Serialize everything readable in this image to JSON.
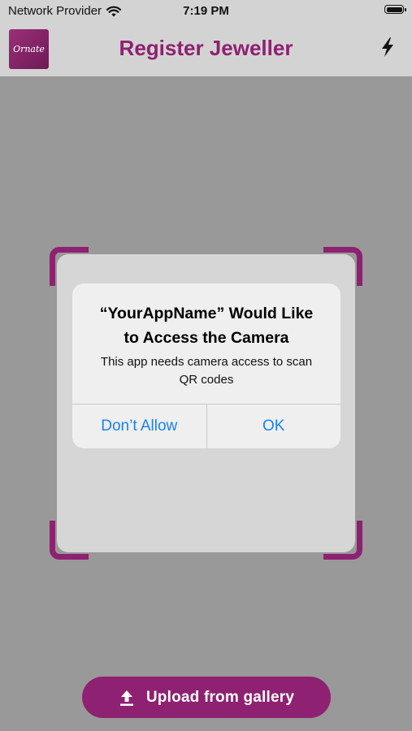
{
  "status_bar": {
    "carrier": "Network Provider",
    "time": "7:19 PM",
    "wifi_icon": "wifi-icon",
    "battery_icon": "battery-icon"
  },
  "app_bar": {
    "title": "Register Jeweller",
    "logo_text": "Ornate",
    "flash_icon": "flash-icon"
  },
  "alert": {
    "title": "“YourAppName” Would Like to Access the Camera",
    "message": "This app needs camera access to scan QR codes",
    "deny_label": "Don’t Allow",
    "ok_label": "OK"
  },
  "upload": {
    "label": "Upload from gallery",
    "icon": "upload-icon"
  },
  "colors": {
    "brand": "#8e2171",
    "ios_blue": "#1a82f0",
    "overlay": "#999999"
  }
}
